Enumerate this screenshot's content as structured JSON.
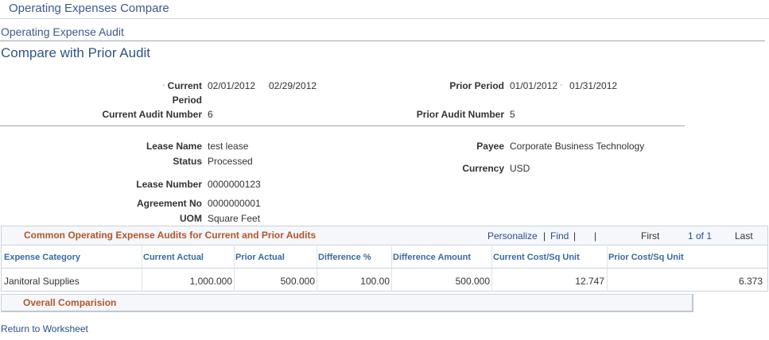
{
  "app": {
    "title": "Operating Expenses Compare"
  },
  "breadcrumb": "Operating Expense Audit",
  "page_title": "Compare with Prior Audit",
  "header": {
    "current_period_label_1": "Current",
    "current_period_label_2": "Period",
    "current_period_start": "02/01/2012",
    "current_period_end": "02/29/2012",
    "period_dash": "-",
    "prior_period_label": "Prior Period",
    "prior_period_start": "01/01/2012",
    "prior_period_end": "01/31/2012",
    "current_audit_label": "Current Audit Number",
    "current_audit_value": "6",
    "prior_audit_label": "Prior Audit Number",
    "prior_audit_value": "5"
  },
  "details": {
    "lease_name_label": "Lease Name",
    "lease_name_value": "test lease",
    "status_label": "Status",
    "status_value": "Processed",
    "lease_number_label": "Lease Number",
    "lease_number_value": "0000000123",
    "agreement_label": "Agreement No",
    "agreement_value": "0000000001",
    "uom_label": "UOM",
    "uom_value": "Square Feet",
    "payee_label": "Payee",
    "payee_value": "Corporate Business Technology",
    "currency_label": "Currency",
    "currency_value": "USD"
  },
  "grid": {
    "title": "Common Operating Expense Audits for Current and Prior Audits",
    "personalize": "Personalize",
    "sep": "|",
    "find": "Find",
    "sep2": "|",
    "sep3": "|",
    "first": "First",
    "range": "1 of 1",
    "last": "Last",
    "columns": [
      "Expense Category",
      "Current Actual",
      "Prior Actual",
      "Difference %",
      "Difference Amount",
      "Current Cost/Sq Unit",
      "Prior Cost/Sq Unit"
    ],
    "rows": [
      [
        "Janitoral Supplies",
        "1,000.000",
        "500.000",
        "100.00",
        "500.000",
        "12.747",
        "6.373"
      ]
    ]
  },
  "overall": {
    "title": "Overall Comparision"
  },
  "footer": {
    "return_link": "Return to Worksheet"
  },
  "colors": {
    "link": "#2a4e8a",
    "section_title": "#b2562a",
    "header_blue": "#3b6aa0"
  }
}
